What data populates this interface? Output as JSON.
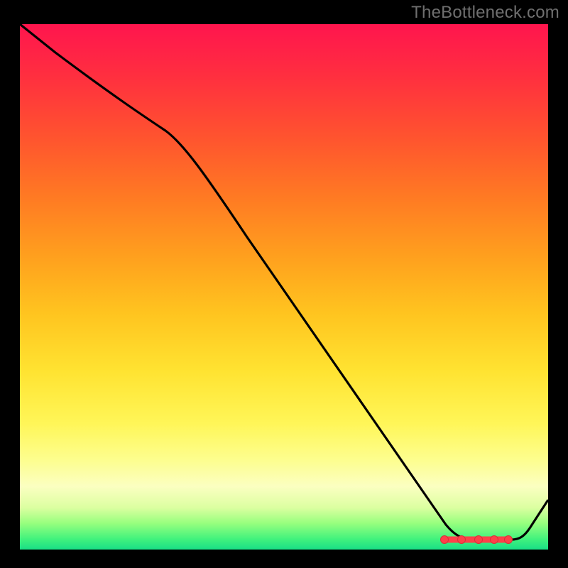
{
  "attribution": "TheBottleneck.com",
  "chart_data": {
    "type": "line",
    "title": "",
    "xlabel": "",
    "ylabel": "",
    "x": [
      0,
      27,
      87,
      94,
      100
    ],
    "values": [
      100,
      80,
      2,
      2,
      15
    ],
    "xlim": [
      0,
      100
    ],
    "ylim": [
      0,
      100
    ],
    "optimal_band": {
      "x_start": 80,
      "x_end": 92,
      "y": 2
    },
    "gradient_meaning": "red-top = high bottleneck, green-bottom = low bottleneck"
  }
}
